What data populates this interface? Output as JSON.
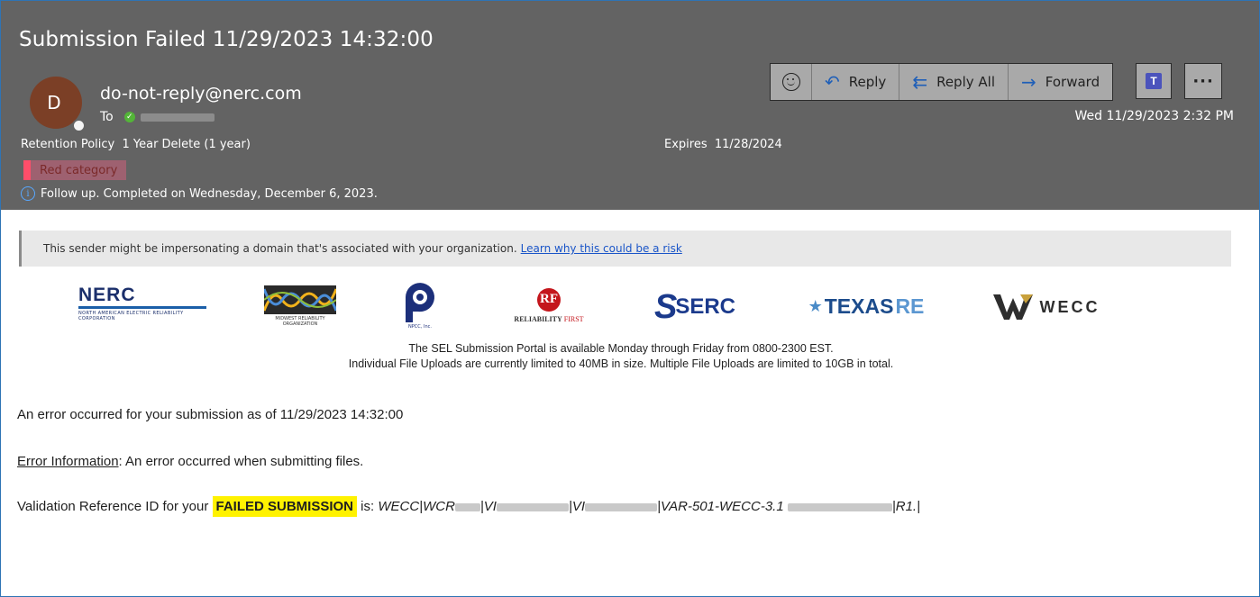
{
  "header": {
    "subject": "Submission Failed 11/29/2023 14:32:00",
    "avatar_letter": "D",
    "sender": "do-not-reply@nerc.com",
    "to_label": "To",
    "retention_label": "Retention Policy",
    "retention_value": "1 Year Delete (1 year)",
    "expires_label": "Expires",
    "expires_value": "11/28/2024",
    "category": "Red category",
    "followup": "Follow up.  Completed on Wednesday, December 6, 2023.",
    "datetime": "Wed 11/29/2023 2:32 PM",
    "actions": {
      "reply": "Reply",
      "reply_all": "Reply All",
      "forward": "Forward",
      "more": "···"
    }
  },
  "warning": {
    "text": "This sender might be impersonating a domain that's associated with your organization.",
    "link": "Learn why this could be a risk"
  },
  "logos": {
    "nerc": "NERC",
    "nerc_sub": "NORTH AMERICAN ELECTRIC RELIABILITY CORPORATION",
    "mro_sub": "MIDWEST RELIABILITY ORGANIZATION",
    "npcc_sub": "NPCC, Inc.",
    "rf_letters": "RF",
    "rf_word": "RELIABILITY",
    "rf_first": "FIRST",
    "serc": "SERC",
    "texas": "TEXAS",
    "texas_re": "RE",
    "wecc": "WECC"
  },
  "portal": {
    "line1": "The  SEL Submission Portal is available Monday through Friday from 0800-2300 EST.",
    "line2": "Individual File Uploads are currently limited to 40MB in size. Multiple File Uploads are limited to 10GB in total."
  },
  "message": {
    "line1": "An error occurred for your submission as of 11/29/2023 14:32:00",
    "error_label": "Error Information",
    "error_text": ": An error occurred when submitting files.",
    "ref_prefix": "Validation Reference ID for your ",
    "ref_highlight": "FAILED SUBMISSION",
    "ref_is": " is: ",
    "ref_part1": "WECC|WCR",
    "ref_part2": "|VI",
    "ref_part3": "|VI",
    "ref_part4": "|VAR-501-WECC-3.1 ",
    "ref_part5": "|R1.|"
  },
  "colors": {
    "header_bg": "#636363",
    "category_swatch": "#ff4e6a",
    "highlight": "#fff200",
    "link": "#1a55c8"
  }
}
